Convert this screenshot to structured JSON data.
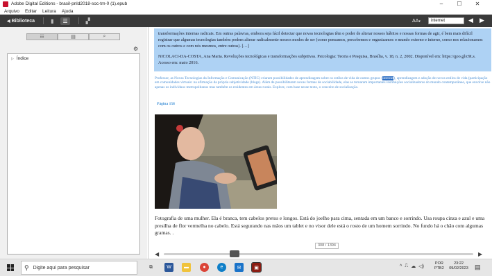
{
  "window": {
    "title": "Adobe Digital Editions - brasil-pnld2018-soc-tm-0 (1).epub",
    "controls": [
      "–",
      "☐",
      "✕"
    ]
  },
  "menu": [
    "Arquivo",
    "Editar",
    "Leitura",
    "Ajuda"
  ],
  "toolbar": {
    "library_label": "Biblioteca",
    "font_size_label": "AA",
    "search_value": "internet"
  },
  "left_panel": {
    "tabs": [
      {
        "icon": "list-icon"
      },
      {
        "icon": "thumbnails-icon"
      },
      {
        "icon": "search-icon"
      }
    ],
    "toc": [
      {
        "label": "Índice"
      }
    ]
  },
  "reader": {
    "quote": "transformações internas radicais. Em outras palavras, embora seja fácil detectar que novas tecnologias têm o poder de alterar nossos hábitos e nossas formas de agir, é bem mais difícil registrar que algumas tecnologias também podem alterar radicalmente nossos modos de ser (como pensamos, percebemos e organizamos o mundo externo e interno, como nos relacionamos com os outros e com nós mesmos, entre outras). […]",
    "citation": "NICOLACI-DA-COSTA, Ana Maria. Revoluções tecnológicas e transformações subjetivas. Psicologia: Teoria e Pesquisa, Brasília, v. 18, n. 2, 2002. Disponível em: https://goo.gl/c9Ls. Acesso em: maio 2016.",
    "definition_before": "Professor, as Novas Tecnologias da Informação e Comunicação (NTIC) criaram possibilidades de aprendizagem sobre os estilos de vida de outros grupos (",
    "definition_highlight": "internet",
    "definition_after": "), aprendizagem e adoção de novos estilos de vida (participação em comunidades virtuais: na afirmação da própria subjetividade (blogs). Além de possibilitarem novas formas de sociabilidade, elas se tornaram importantes instituições socializadoras do mundo contemporâneo, que envolve não apenas os indivíduos metropolitanos mas também os residentes em áreas rurais. Explore, com base nesse texto, o conceito de socialização.",
    "page_marker": "Página 158",
    "caption": "Fotografia de uma mulher. Ela é branca, tem cabelos pretos e longos. Está do joelho para cima, sentada em um banco e sorrindo. Usa roupa cinza e azul e uma presilha de flor vermelha no cabelo. Está segurando nas mãos um tablet e no visor dele está o rosto de um homem sorrindo. No fundo há o chão com algumas gramas. .",
    "page_count": "308 / 1394",
    "progress": 0.22
  },
  "taskbar": {
    "search_placeholder": "Digite aqui para pesquisar",
    "lang_top": "POR",
    "lang_bottom": "PTB2",
    "time": "23:22",
    "date": "09/02/2023"
  }
}
